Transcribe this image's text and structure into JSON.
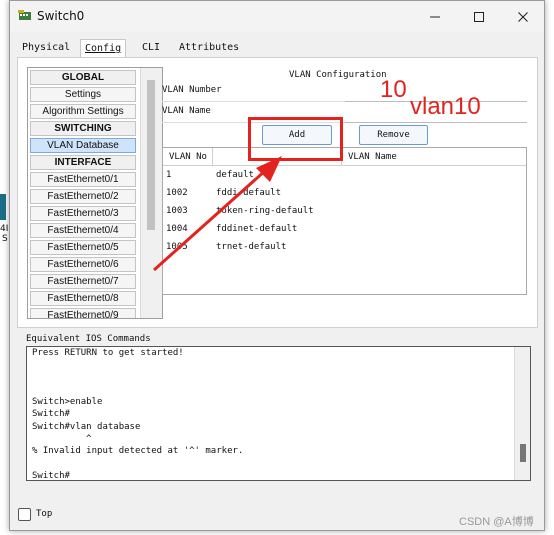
{
  "window": {
    "title": "Switch0"
  },
  "tabs": [
    {
      "label": "Physical"
    },
    {
      "label": "Config"
    },
    {
      "label": "CLI"
    },
    {
      "label": "Attributes"
    }
  ],
  "sidebar": {
    "items": [
      {
        "label": "GLOBAL",
        "kind": "heading"
      },
      {
        "label": "Settings"
      },
      {
        "label": "Algorithm Settings"
      },
      {
        "label": "SWITCHING",
        "kind": "heading"
      },
      {
        "label": "VLAN Database",
        "selected": true
      },
      {
        "label": "INTERFACE",
        "kind": "heading"
      },
      {
        "label": "FastEthernet0/1"
      },
      {
        "label": "FastEthernet0/2"
      },
      {
        "label": "FastEthernet0/3"
      },
      {
        "label": "FastEthernet0/4"
      },
      {
        "label": "FastEthernet0/5"
      },
      {
        "label": "FastEthernet0/6"
      },
      {
        "label": "FastEthernet0/7"
      },
      {
        "label": "FastEthernet0/8"
      },
      {
        "label": "FastEthernet0/9"
      }
    ]
  },
  "vlan_config": {
    "title": "VLAN Configuration",
    "number_label": "VLAN Number",
    "number_value": "",
    "name_label": "VLAN Name",
    "name_value": "",
    "add_label": "Add",
    "remove_label": "Remove",
    "table": {
      "columns": [
        "VLAN No",
        "VLAN Name"
      ],
      "rows": [
        {
          "no": "1",
          "name": "default"
        },
        {
          "no": "1002",
          "name": "fddi-default"
        },
        {
          "no": "1003",
          "name": "token-ring-default"
        },
        {
          "no": "1004",
          "name": "fddinet-default"
        },
        {
          "no": "1005",
          "name": "trnet-default"
        }
      ]
    }
  },
  "ios": {
    "label": "Equivalent IOS Commands",
    "lines": [
      "Press RETURN to get started!",
      "",
      "",
      "",
      "Switch>enable",
      "Switch#",
      "Switch#vlan database",
      "          ^",
      "% Invalid input detected at '^' marker.",
      "",
      "Switch#"
    ]
  },
  "footer": {
    "top_label": "Top",
    "top_checked": false
  },
  "annotations": {
    "number_text": "10",
    "name_text": "vlan10",
    "color": "#e3231d"
  },
  "background": {
    "left_text_1": "4I",
    "left_text_2": "S"
  },
  "watermark": "CSDN @A博博"
}
